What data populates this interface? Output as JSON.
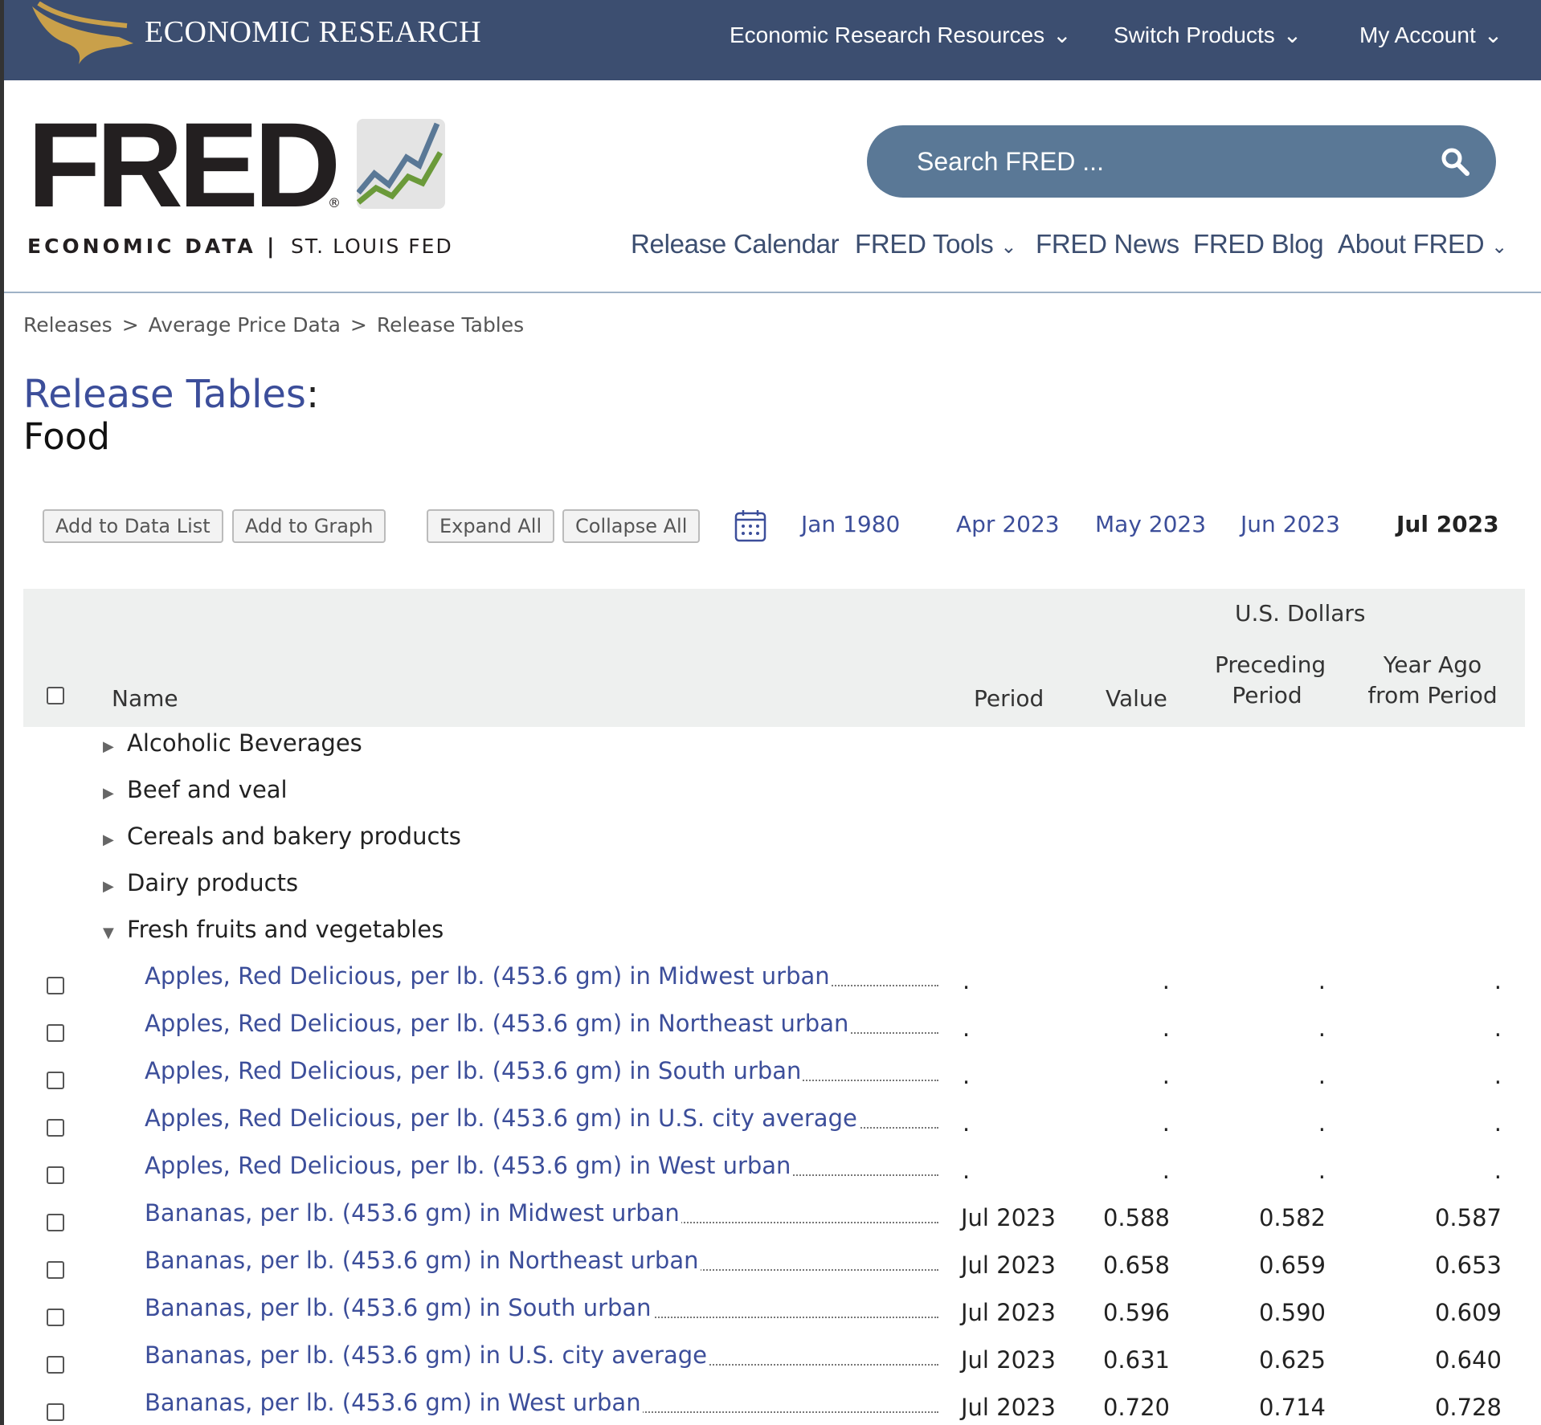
{
  "topbar": {
    "brand": "ECONOMIC RESEARCH",
    "nav": [
      "Economic Research Resources",
      "Switch Products",
      "My Account"
    ]
  },
  "header": {
    "logo": "FRED",
    "tagline_left": "ECONOMIC DATA",
    "tagline_sep": "|",
    "tagline_right": "ST. LOUIS FED",
    "search_placeholder": "Search FRED ...",
    "nav": [
      "Release Calendar",
      "FRED Tools",
      "FRED News",
      "FRED Blog",
      "About FRED"
    ]
  },
  "breadcrumb": [
    "Releases",
    "Average Price Data",
    "Release Tables"
  ],
  "page": {
    "title": "Release Tables",
    "colon": ":",
    "subtitle": "Food"
  },
  "toolbar": {
    "buttons": [
      "Add to Data List",
      "Add to Graph",
      "Expand All",
      "Collapse All"
    ],
    "dates": [
      "Jan 1980",
      "Apr 2023",
      "May 2023",
      "Jun 2023"
    ],
    "active_date": "Jul 2023"
  },
  "table": {
    "units": "U.S. Dollars",
    "headers": {
      "name": "Name",
      "period": "Period",
      "value": "Value",
      "preceding_1": "Preceding",
      "preceding_2": "Period",
      "yearago_1": "Year Ago",
      "yearago_2": "from Period"
    },
    "categories": [
      {
        "label": "Alcoholic Beverages",
        "expanded": false
      },
      {
        "label": "Beef and veal",
        "expanded": false
      },
      {
        "label": "Cereals and bakery products",
        "expanded": false
      },
      {
        "label": "Dairy products",
        "expanded": false
      },
      {
        "label": "Fresh fruits and vegetables",
        "expanded": true
      }
    ],
    "rows": [
      {
        "name": "Apples, Red Delicious, per lb. (453.6 gm) in Midwest urban",
        "period": ".",
        "value": ".",
        "preceding": ".",
        "year_ago": "."
      },
      {
        "name": "Apples, Red Delicious, per lb. (453.6 gm) in Northeast urban",
        "period": ".",
        "value": ".",
        "preceding": ".",
        "year_ago": "."
      },
      {
        "name": "Apples, Red Delicious, per lb. (453.6 gm) in South urban",
        "period": ".",
        "value": ".",
        "preceding": ".",
        "year_ago": "."
      },
      {
        "name": "Apples, Red Delicious, per lb. (453.6 gm) in U.S. city average",
        "period": ".",
        "value": ".",
        "preceding": ".",
        "year_ago": "."
      },
      {
        "name": "Apples, Red Delicious, per lb. (453.6 gm) in West urban",
        "period": ".",
        "value": ".",
        "preceding": ".",
        "year_ago": "."
      },
      {
        "name": "Bananas, per lb. (453.6 gm) in Midwest urban",
        "period": "Jul 2023",
        "value": "0.588",
        "preceding": "0.582",
        "year_ago": "0.587"
      },
      {
        "name": "Bananas, per lb. (453.6 gm) in Northeast urban",
        "period": "Jul 2023",
        "value": "0.658",
        "preceding": "0.659",
        "year_ago": "0.653"
      },
      {
        "name": "Bananas, per lb. (453.6 gm) in South urban",
        "period": "Jul 2023",
        "value": "0.596",
        "preceding": "0.590",
        "year_ago": "0.609"
      },
      {
        "name": "Bananas, per lb. (453.6 gm) in U.S. city average",
        "period": "Jul 2023",
        "value": "0.631",
        "preceding": "0.625",
        "year_ago": "0.640"
      },
      {
        "name": "Bananas, per lb. (453.6 gm) in West urban",
        "period": "Jul 2023",
        "value": "0.720",
        "preceding": "0.714",
        "year_ago": "0.728"
      }
    ]
  },
  "colors": {
    "topbar": "#3c4e70",
    "link": "#3c4e9a",
    "search": "#5a7896",
    "table_header_bg": "#eef0ef"
  }
}
